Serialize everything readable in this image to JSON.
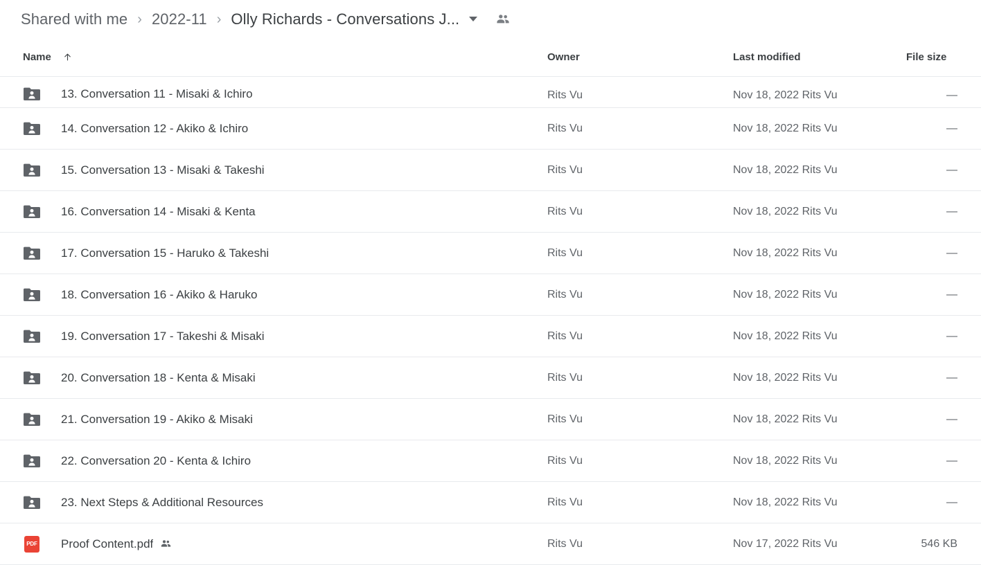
{
  "breadcrumb": {
    "items": [
      {
        "label": "Shared with me",
        "current": false
      },
      {
        "label": "2022-11",
        "current": false
      },
      {
        "label": "Olly Richards - Conversations J...",
        "current": true
      }
    ],
    "separator": "›",
    "caret_icon": "chevron-down-icon",
    "shared_icon": "people-icon"
  },
  "table": {
    "headers": {
      "name": "Name",
      "owner": "Owner",
      "last_modified": "Last modified",
      "file_size": "File size"
    },
    "sort": {
      "column": "Name",
      "direction": "ascending",
      "icon": "arrow-up-icon"
    },
    "rows": [
      {
        "name": "13. Conversation 11 - Misaki & Ichiro",
        "icon": "shared-folder-icon",
        "owner": "Rits Vu",
        "last_modified": "Nov 18, 2022 Rits Vu",
        "file_size": "—",
        "shared_badge": false
      },
      {
        "name": "14. Conversation 12 - Akiko & Ichiro",
        "icon": "shared-folder-icon",
        "owner": "Rits Vu",
        "last_modified": "Nov 18, 2022 Rits Vu",
        "file_size": "—",
        "shared_badge": false
      },
      {
        "name": "15. Conversation 13 - Misaki & Takeshi",
        "icon": "shared-folder-icon",
        "owner": "Rits Vu",
        "last_modified": "Nov 18, 2022 Rits Vu",
        "file_size": "—",
        "shared_badge": false
      },
      {
        "name": "16. Conversation 14 - Misaki & Kenta",
        "icon": "shared-folder-icon",
        "owner": "Rits Vu",
        "last_modified": "Nov 18, 2022 Rits Vu",
        "file_size": "—",
        "shared_badge": false
      },
      {
        "name": "17. Conversation 15 - Haruko & Takeshi",
        "icon": "shared-folder-icon",
        "owner": "Rits Vu",
        "last_modified": "Nov 18, 2022 Rits Vu",
        "file_size": "—",
        "shared_badge": false
      },
      {
        "name": "18. Conversation 16 - Akiko & Haruko",
        "icon": "shared-folder-icon",
        "owner": "Rits Vu",
        "last_modified": "Nov 18, 2022 Rits Vu",
        "file_size": "—",
        "shared_badge": false
      },
      {
        "name": "19. Conversation 17 - Takeshi & Misaki",
        "icon": "shared-folder-icon",
        "owner": "Rits Vu",
        "last_modified": "Nov 18, 2022 Rits Vu",
        "file_size": "—",
        "shared_badge": false
      },
      {
        "name": "20. Conversation 18 - Kenta & Misaki",
        "icon": "shared-folder-icon",
        "owner": "Rits Vu",
        "last_modified": "Nov 18, 2022 Rits Vu",
        "file_size": "—",
        "shared_badge": false
      },
      {
        "name": "21. Conversation 19 - Akiko & Misaki",
        "icon": "shared-folder-icon",
        "owner": "Rits Vu",
        "last_modified": "Nov 18, 2022 Rits Vu",
        "file_size": "—",
        "shared_badge": false
      },
      {
        "name": "22. Conversation 20 - Kenta & Ichiro",
        "icon": "shared-folder-icon",
        "owner": "Rits Vu",
        "last_modified": "Nov 18, 2022 Rits Vu",
        "file_size": "—",
        "shared_badge": false
      },
      {
        "name": "23. Next Steps & Additional Resources",
        "icon": "shared-folder-icon",
        "owner": "Rits Vu",
        "last_modified": "Nov 18, 2022 Rits Vu",
        "file_size": "—",
        "shared_badge": false
      },
      {
        "name": "Proof Content.pdf",
        "icon": "pdf-file-icon",
        "icon_label": "PDF",
        "owner": "Rits Vu",
        "last_modified": "Nov 17, 2022 Rits Vu",
        "file_size": "546 KB",
        "shared_badge": true
      }
    ]
  },
  "colors": {
    "folder": "#5f6368",
    "pdf": "#ea4335",
    "text_primary": "#3c4043",
    "text_secondary": "#5f6368",
    "divider": "#e8eaed"
  }
}
